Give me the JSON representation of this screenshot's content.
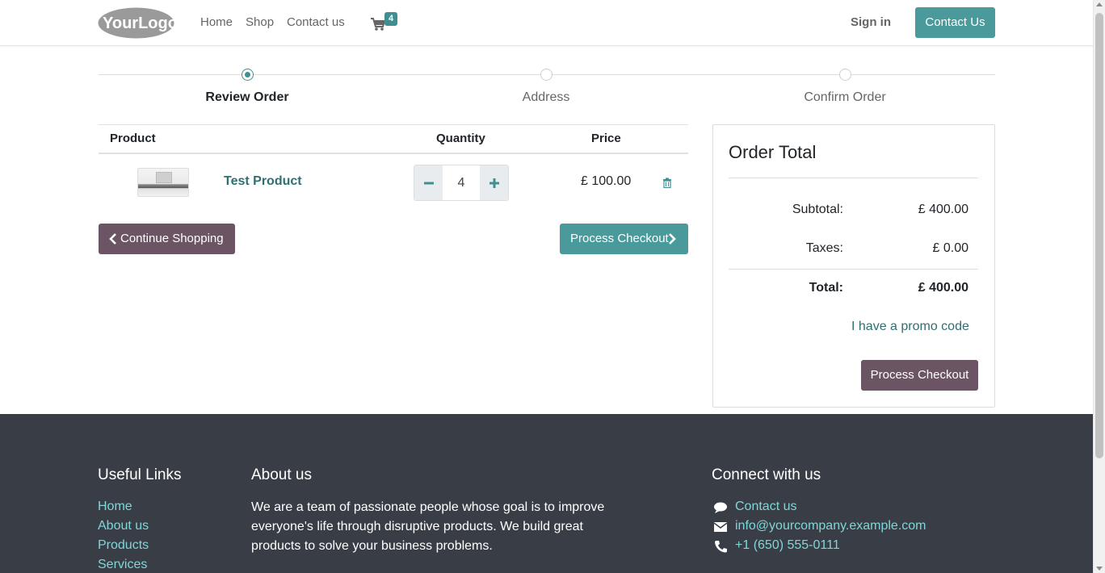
{
  "header": {
    "logo_text": "YourLogo",
    "nav": [
      {
        "label": "Home"
      },
      {
        "label": "Shop"
      },
      {
        "label": "Contact us"
      }
    ],
    "cart_count": "4",
    "sign_in_label": "Sign in",
    "contact_button_label": "Contact Us"
  },
  "steps": [
    {
      "label": "Review Order",
      "active": true
    },
    {
      "label": "Address",
      "active": false
    },
    {
      "label": "Confirm Order",
      "active": false
    }
  ],
  "cart_table": {
    "headers": {
      "product": "Product",
      "quantity": "Quantity",
      "price": "Price"
    },
    "rows": [
      {
        "name": "Test Product",
        "quantity": "4",
        "price": "£ 100.00"
      }
    ]
  },
  "actions": {
    "continue_label": "Continue Shopping",
    "checkout_label": "Process Checkout"
  },
  "order_total": {
    "title": "Order Total",
    "subtotal_label": "Subtotal:",
    "subtotal_value": "£ 400.00",
    "taxes_label": "Taxes:",
    "taxes_value": "£ 0.00",
    "total_label": "Total:",
    "total_value": "£ 400.00",
    "promo_label": "I have a promo code",
    "checkout_label": "Process Checkout"
  },
  "footer": {
    "useful_links_title": "Useful Links",
    "useful_links": [
      "Home",
      "About us",
      "Products",
      "Services"
    ],
    "about_title": "About us",
    "about_text": "We are a team of passionate people whose goal is to improve everyone's life through disruptive products. We build great products to solve your business problems.",
    "connect_title": "Connect with us",
    "connect_items": [
      {
        "icon": "comment-icon",
        "label": "Contact us"
      },
      {
        "icon": "envelope-icon",
        "label": "info@yourcompany.example.com"
      },
      {
        "icon": "phone-icon",
        "label": "+1 (650) 555-0111"
      }
    ]
  },
  "colors": {
    "primary": "#4a9a9c",
    "secondary": "#6b5464",
    "link": "#2f6f71",
    "footer_bg": "#393e46",
    "footer_link": "#7fd6d8"
  }
}
